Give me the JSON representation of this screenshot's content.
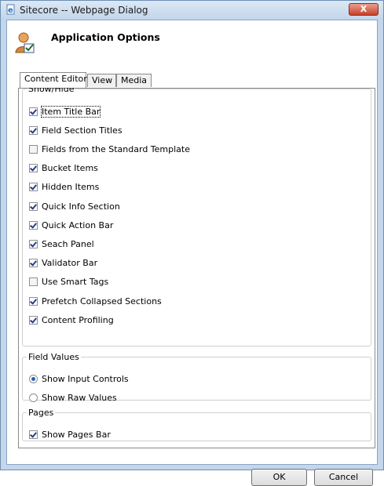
{
  "window": {
    "title": "Sitecore -- Webpage Dialog",
    "close_label": "X"
  },
  "header": {
    "title": "Application Options"
  },
  "tabs": [
    {
      "label": "Content Editor",
      "active": true
    },
    {
      "label": "View",
      "active": false
    },
    {
      "label": "Media",
      "active": false
    }
  ],
  "show_hide": {
    "legend": "Show/Hide",
    "items": [
      {
        "label": "Item Title Bar",
        "checked": true
      },
      {
        "label": "Field Section Titles",
        "checked": true
      },
      {
        "label": "Fields from the Standard Template",
        "checked": false
      },
      {
        "label": "Bucket Items",
        "checked": true
      },
      {
        "label": "Hidden Items",
        "checked": true
      },
      {
        "label": "Quick Info Section",
        "checked": true
      },
      {
        "label": "Quick Action Bar",
        "checked": true
      },
      {
        "label": "Seach Panel",
        "checked": true
      },
      {
        "label": "Validator Bar",
        "checked": true
      },
      {
        "label": "Use Smart Tags",
        "checked": false
      },
      {
        "label": "Prefetch Collapsed Sections",
        "checked": true
      },
      {
        "label": "Content Profiling",
        "checked": true
      }
    ]
  },
  "field_values": {
    "legend": "Field Values",
    "options": [
      {
        "label": "Show Input Controls",
        "selected": true
      },
      {
        "label": "Show Raw Values",
        "selected": false
      }
    ]
  },
  "pages": {
    "legend": "Pages",
    "items": [
      {
        "label": "Show Pages Bar",
        "checked": true
      }
    ]
  },
  "buttons": {
    "ok": "OK",
    "cancel": "Cancel"
  }
}
